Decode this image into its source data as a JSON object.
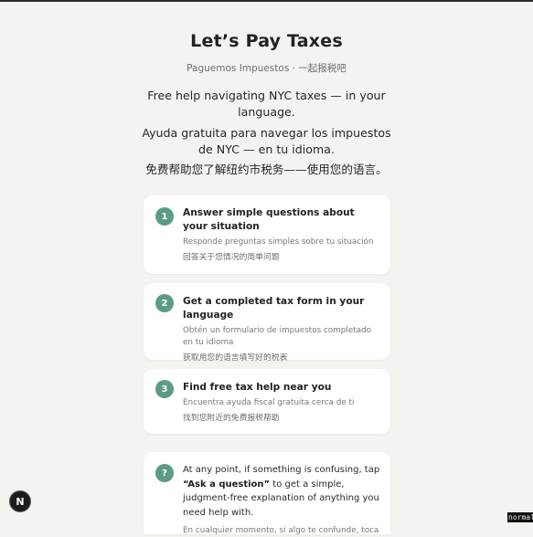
{
  "header": {
    "title": "Let’s Pay Taxes",
    "subtitle": "Paguemos Impuestos · 一起报税吧"
  },
  "intro": {
    "en": "Free help navigating NYC taxes — in your language.",
    "es": "Ayuda gratuita para navegar los impuestos de NYC — en tu idioma.",
    "zh": "免费帮助您了解纽约市税务——使用您的语言。"
  },
  "steps": [
    {
      "number": "1",
      "en": "Answer simple questions about your situation",
      "es": "Responde preguntas simples sobre tu situación",
      "zh": "回答关于您情况的简单问题"
    },
    {
      "number": "2",
      "en": "Get a completed tax form in your language",
      "es": "Obtén un formulario de impuestos completado en tu idioma",
      "zh": "获取用您的语言填写好的税表"
    },
    {
      "number": "3",
      "en": "Find free tax help near you",
      "es": "Encuentra ayuda fiscal gratuita cerca de ti",
      "zh": "找到您附近的免费报税帮助"
    }
  ],
  "help": {
    "badge": "?",
    "text_before": "At any point, if something is confusing, tap ",
    "text_bold": "“Ask a question”",
    "text_after": " to get a simple, judgment-free explanation of anything you need help with.",
    "es": "En cualquier momento, si algo te confunde, toca"
  },
  "fab": {
    "label": "N"
  },
  "status": {
    "mode": "normal"
  },
  "colors": {
    "accent": "#5c9c87",
    "background": "#f4f3f0",
    "card": "#ffffff"
  }
}
